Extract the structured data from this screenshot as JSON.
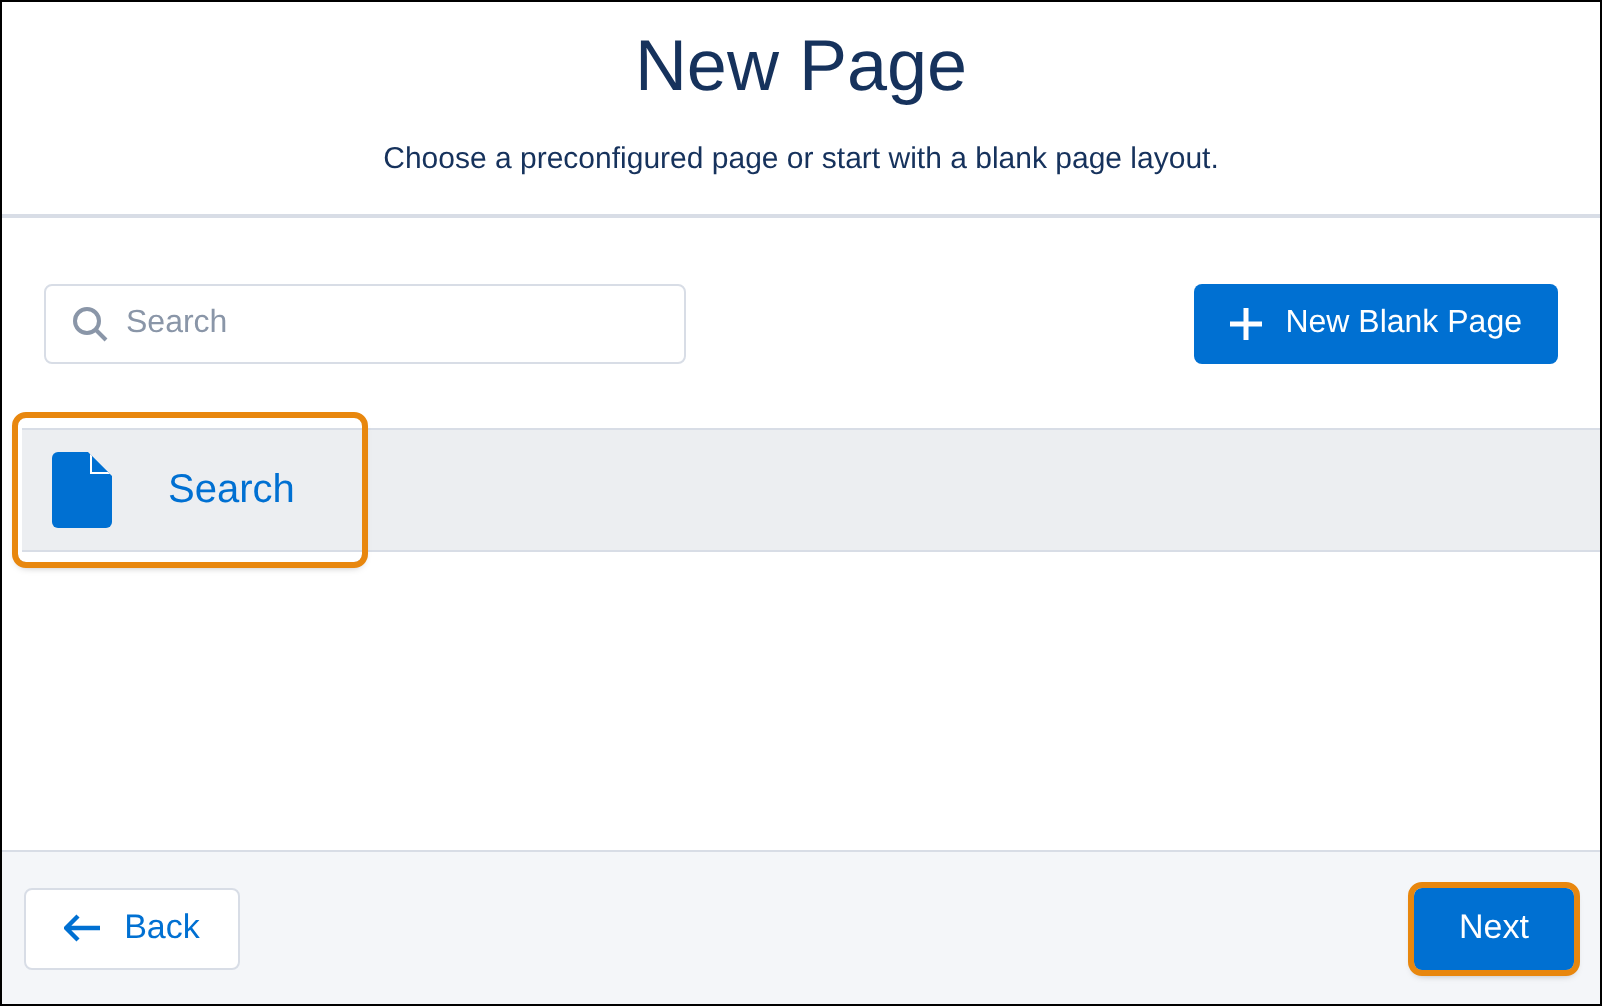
{
  "header": {
    "title": "New Page",
    "subtitle": "Choose a preconfigured page or start with a blank page layout."
  },
  "search": {
    "placeholder": "Search"
  },
  "new_button": {
    "label": "New Blank Page"
  },
  "pages": [
    {
      "label": "Search",
      "selected": true,
      "highlighted": true
    }
  ],
  "footer": {
    "back": {
      "label": "Back",
      "highlighted": false
    },
    "next": {
      "label": "Next",
      "highlighted": true
    }
  }
}
